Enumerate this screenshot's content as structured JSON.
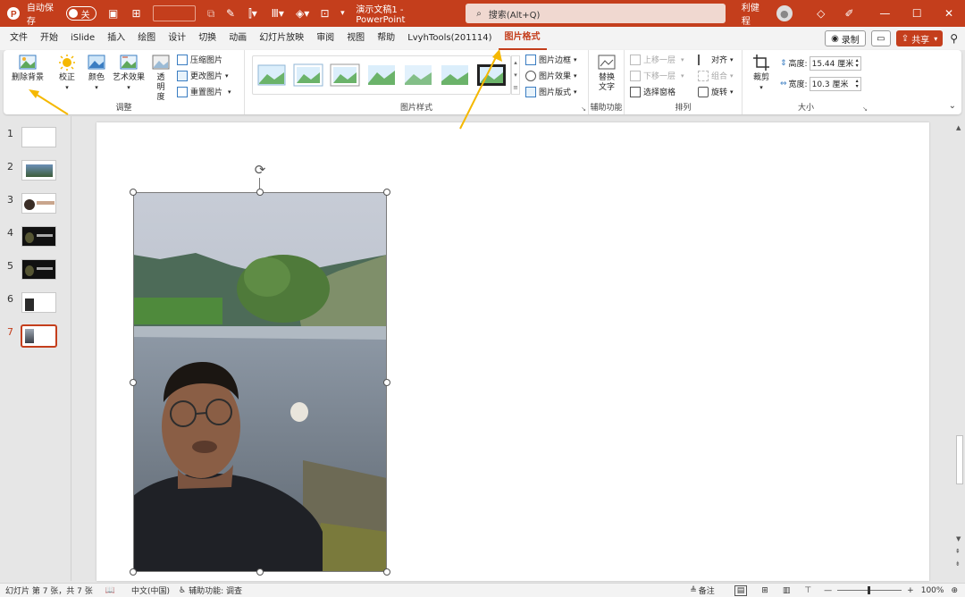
{
  "titlebar": {
    "autosave_label": "自动保存",
    "autosave_state": "关",
    "doc_title": "演示文稿1 - PowerPoint",
    "search_placeholder": "搜索(Alt+Q)",
    "user_name": "利健 程",
    "min_icon": "minimize-icon",
    "max_icon": "maximize-icon",
    "close_icon": "close-icon"
  },
  "tabs": [
    "文件",
    "开始",
    "iSlide",
    "插入",
    "绘图",
    "设计",
    "切换",
    "动画",
    "幻灯片放映",
    "审阅",
    "视图",
    "帮助",
    "LvyhTools(201114)",
    "图片格式"
  ],
  "active_tab": "图片格式",
  "record_label": "录制",
  "share_label": "共享",
  "ribbon": {
    "remove_bg": "删除背景",
    "correct": "校正",
    "color": "颜色",
    "art": "艺术效果",
    "transparency": "透明度",
    "compress": "压缩图片",
    "change": "更改图片",
    "reset": "重置图片",
    "adjust_group": "调整",
    "style_group": "图片样式",
    "border": "图片边框",
    "effects": "图片效果",
    "layout": "图片版式",
    "alt_text": "替换文字",
    "access_group": "辅助功能",
    "bring_forward": "上移一层",
    "send_backward": "下移一层",
    "selection_pane": "选择窗格",
    "align": "对齐",
    "group": "组合",
    "rotate": "旋转",
    "arrange_group": "排列",
    "crop": "裁剪",
    "height_label": "高度:",
    "height_value": "15.44 厘米",
    "width_label": "宽度:",
    "width_value": "10.3 厘米",
    "size_group": "大小"
  },
  "slides": [
    "1",
    "2",
    "3",
    "4",
    "5",
    "6",
    "7"
  ],
  "current_slide": "7",
  "status": {
    "slide_info": "幻灯片 第 7 张，共 7 张",
    "language": "中文(中国)",
    "accessibility": "辅助功能: 调查",
    "notes": "备注",
    "zoom": "100%"
  },
  "colors": {
    "accent": "#c43e1c",
    "arrow": "#f5b800"
  }
}
